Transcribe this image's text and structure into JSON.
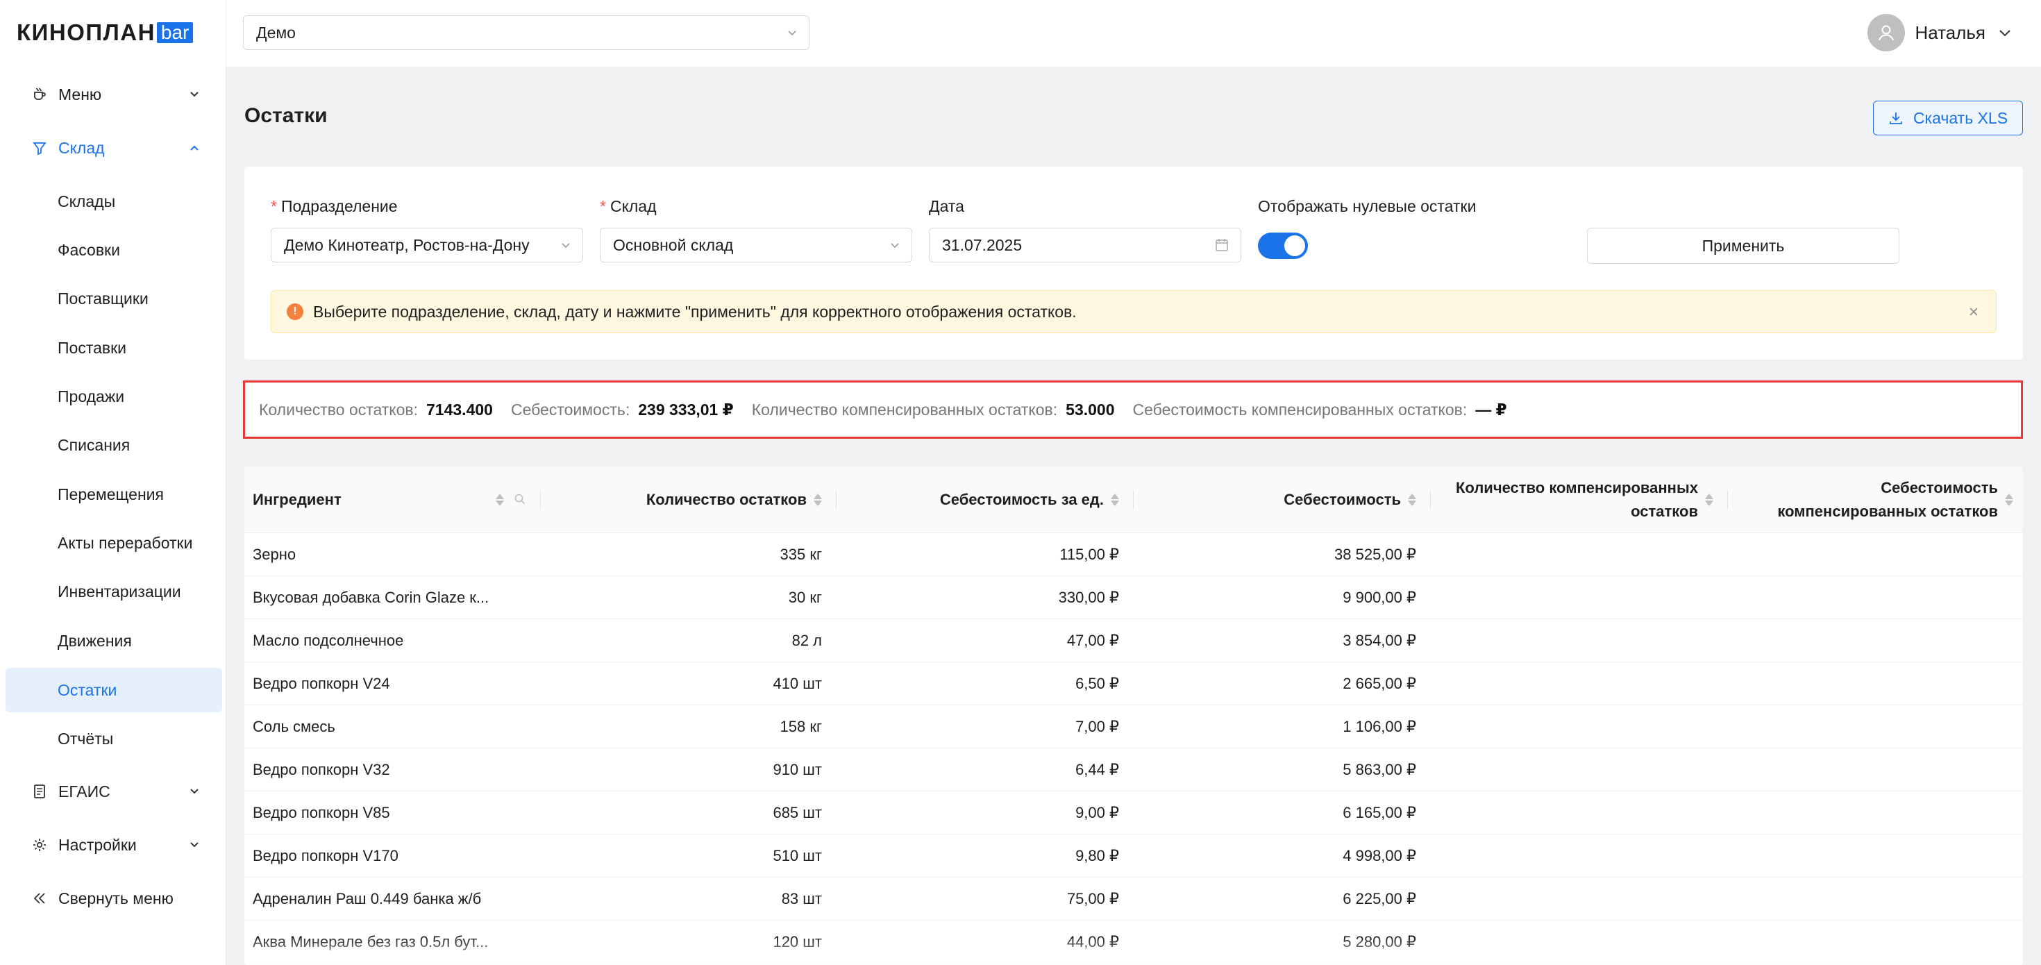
{
  "brand": {
    "word": "КИНОПЛАН",
    "suffix": "bar"
  },
  "topbar": {
    "unit_select": "Демо",
    "user_name": "Наталья"
  },
  "sidebar": {
    "groups": [
      {
        "label": "Меню",
        "icon": "cup-icon"
      },
      {
        "label": "Склад",
        "icon": "funnel-icon"
      },
      {
        "label": "ЕГАИС",
        "icon": "document-icon"
      },
      {
        "label": "Настройки",
        "icon": "gear-icon"
      },
      {
        "label": "Свернуть меню",
        "icon": "double-chevron-left-icon"
      }
    ],
    "items": [
      "Склады",
      "Фасовки",
      "Поставщики",
      "Поставки",
      "Продажи",
      "Списания",
      "Перемещения",
      "Акты переработки",
      "Инвентаризации",
      "Движения",
      "Остатки",
      "Отчёты"
    ],
    "selected": "Остатки"
  },
  "page": {
    "title": "Остатки",
    "download_label": "Скачать XLS"
  },
  "filters": {
    "division_label": "Подразделение",
    "division_value": "Демо Кинотеатр, Ростов-на-Дону",
    "warehouse_label": "Склад",
    "warehouse_value": "Основной склад",
    "date_label": "Дата",
    "date_value": "31.07.2025",
    "zero_label": "Отображать нулевые остатки",
    "zero_enabled": true,
    "required_mark": "*",
    "apply_label": "Применить"
  },
  "alert": {
    "text": "Выберите подразделение, склад, дату и нажмите \"применить\" для корректного отображения остатков."
  },
  "summary": {
    "qty_label": "Количество остатков:",
    "qty_value": "7143.400",
    "cost_label": "Себестоимость:",
    "cost_value": "239 333,01 ₽",
    "comp_qty_label": "Количество компенсированных остатков:",
    "comp_qty_value": "53.000",
    "comp_cost_label": "Себестоимость компенсированных остатков:",
    "comp_cost_value": "— ₽"
  },
  "table": {
    "columns": [
      "Ингредиент",
      "Количество остатков",
      "Себестоимость за ед.",
      "Себестоимость",
      "Количество компенсированных остатков",
      "Себестоимость компенсированных остатков"
    ],
    "rows": [
      [
        "Зерно",
        "335 кг",
        "115,00 ₽",
        "38 525,00 ₽"
      ],
      [
        "Вкусовая добавка Corin Glaze к...",
        "30 кг",
        "330,00 ₽",
        "9 900,00 ₽"
      ],
      [
        "Масло подсолнечное",
        "82 л",
        "47,00 ₽",
        "3 854,00 ₽"
      ],
      [
        "Ведро попкорн V24",
        "410 шт",
        "6,50 ₽",
        "2 665,00 ₽"
      ],
      [
        "Соль смесь",
        "158 кг",
        "7,00 ₽",
        "1 106,00 ₽"
      ],
      [
        "Ведро попкорн V32",
        "910 шт",
        "6,44 ₽",
        "5 863,00 ₽"
      ],
      [
        "Ведро попкорн V85",
        "685 шт",
        "9,00 ₽",
        "6 165,00 ₽"
      ],
      [
        "Ведро попкорн V170",
        "510 шт",
        "9,80 ₽",
        "4 998,00 ₽"
      ],
      [
        "Адреналин Раш 0.449 банка ж/б",
        "83 шт",
        "75,00 ₽",
        "6 225,00 ₽"
      ],
      [
        "Аква Минерале без газ 0.5л бут...",
        "120 шт",
        "44,00 ₽",
        "5 280,00 ₽"
      ]
    ]
  },
  "colors": {
    "accent": "#1a73e8",
    "highlight_border": "#e53935",
    "alert_bg": "#fff8e1",
    "warning_icon": "#f5803e"
  }
}
